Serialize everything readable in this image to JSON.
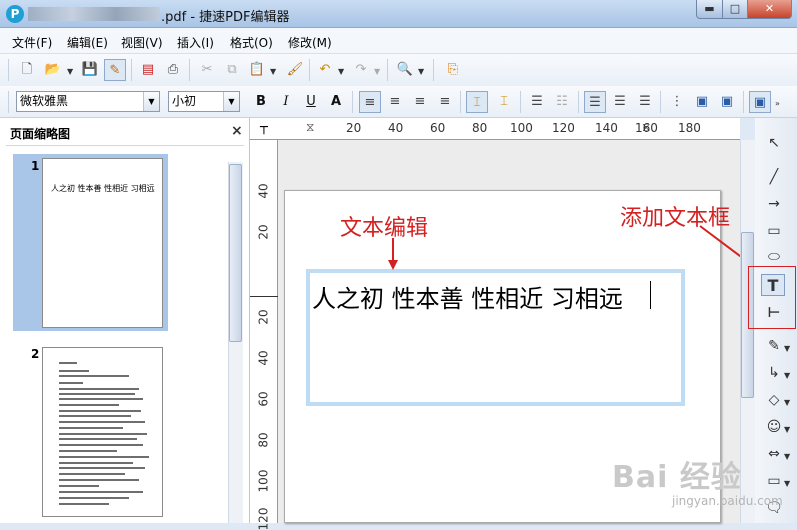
{
  "window": {
    "title": ".pdf - 捷速PDF编辑器",
    "app_icon": "P",
    "controls": {
      "min": "▬",
      "max": "□",
      "close": "✕"
    }
  },
  "menu": [
    "文件(F)",
    "编辑(E)",
    "视图(V)",
    "插入(I)",
    "格式(O)",
    "修改(M)"
  ],
  "toolbar2": {
    "font_family": "微软雅黑",
    "font_size": "小初",
    "bold": "B",
    "italic": "I",
    "underline": "U",
    "color_a": "A"
  },
  "left_panel": {
    "title": "页面缩略图",
    "close": "×",
    "thumb1_number": "1",
    "thumb2_number": "2",
    "thumb1_text": "人之初 性本善 性相近 习相远"
  },
  "rulers": {
    "h_labels": [
      "20",
      "40",
      "60",
      "80",
      "100",
      "120",
      "140",
      "160",
      "180"
    ],
    "v_labels": [
      "40",
      "20",
      "20",
      "40",
      "60",
      "80",
      "100",
      "120"
    ]
  },
  "document": {
    "text": "人之初 性本善 性相近 习相远"
  },
  "annotations": {
    "edit": "文本编辑",
    "add": "添加文本框"
  },
  "watermark": {
    "main": "Bai 经验",
    "sub": "jingyan.baidu.com"
  }
}
